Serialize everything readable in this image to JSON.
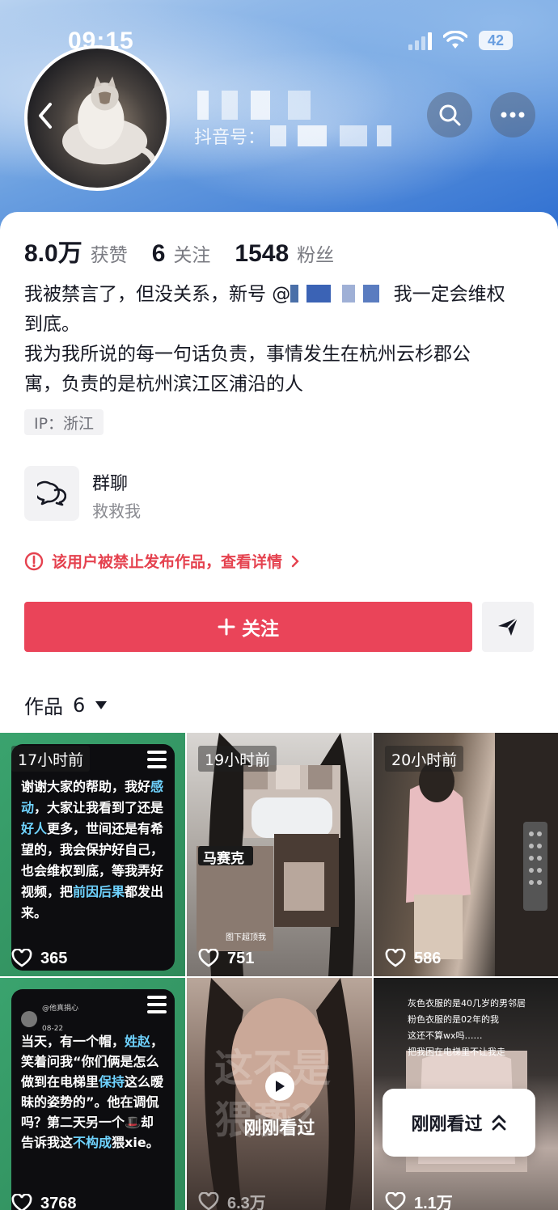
{
  "status_bar": {
    "time": "09:15",
    "battery": "42"
  },
  "profile": {
    "douyin_id_label": "抖音号：",
    "stats": [
      {
        "value": "8.0万",
        "label": "获赞"
      },
      {
        "value": "6",
        "label": "关注"
      },
      {
        "value": "1548",
        "label": "粉丝"
      }
    ],
    "bio_line1_prefix": "我被禁言了，但没关系，新号 @",
    "bio_line1_suffix": " 我一定会维权",
    "bio_line2": "到底。",
    "bio_line3": "我为我所说的每一句话负责，事情发生在杭州云杉郡公",
    "bio_line4": "寓，负责的是杭州滨江区浦沿的人",
    "ip": "IP：浙江"
  },
  "group_chat": {
    "title": "群聊",
    "subtitle": "救救我"
  },
  "notice": {
    "text": "该用户被禁止发布作品，查看详情",
    "color": "#e5424f"
  },
  "actions": {
    "follow_label": "关注",
    "follow_color": "#ea4459"
  },
  "works_tab": {
    "label": "作品",
    "count": "6"
  },
  "videos": [
    {
      "time": "17小时前",
      "likes": "365",
      "text_parts": [
        "谢谢大家的帮助，我好",
        "感动",
        "，大家让我看到了还是",
        "好人",
        "更多，世间还是有希望的，我会保护好自己，也会维权到底，等我弄好视频，把",
        "前因后果",
        "都发出来。"
      ]
    },
    {
      "time": "19小时前",
      "likes": "751",
      "sticker": "马赛克",
      "small_caption": "图下超顶我"
    },
    {
      "time": "20小时前",
      "likes": "586"
    },
    {
      "likes": "3768",
      "author": "@他真捐心",
      "date": "08-22",
      "text_parts": [
        "当天，有一个帽，",
        "姓赵",
        "，笑着问我“你们俩是怎么做到在电梯里",
        "保持",
        "这么暧昧的姿势的”。他在调侃吗？第二天另一个🎩却告诉我这",
        "不构成",
        "猥xie。"
      ]
    },
    {
      "likes": "6.3万",
      "overlay_text": "这不是猥亵？",
      "watched_label": "刚刚看过"
    },
    {
      "likes": "1.1万",
      "caption_lines": [
        "灰色衣服的是40几岁的男邻居",
        "粉色衣服的是02年的我",
        "这还不算wx吗……",
        "把我困在电梯里不让我走"
      ]
    }
  ],
  "recent_button": {
    "label": "刚刚看过"
  }
}
